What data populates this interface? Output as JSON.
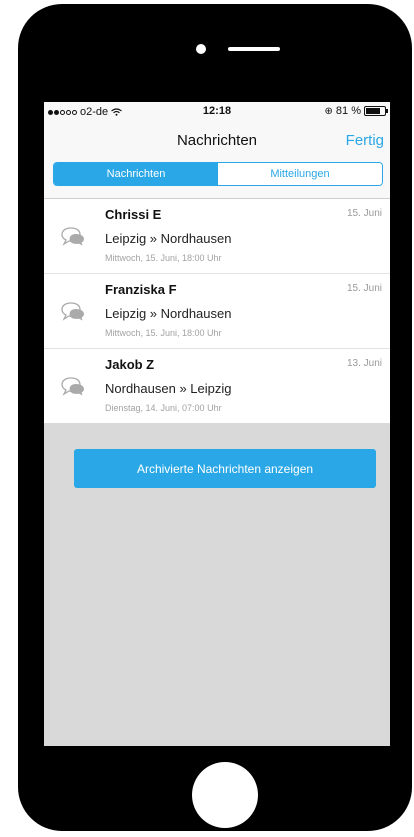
{
  "status_bar": {
    "carrier": "o2-de",
    "time": "12:18",
    "battery": "81 %"
  },
  "nav": {
    "title": "Nachrichten",
    "done_label": "Fertig"
  },
  "segments": {
    "active": "Nachrichten",
    "inactive": "Mitteilungen"
  },
  "messages": [
    {
      "name": "Chrissi E",
      "date": "15. Juni",
      "route": "Leipzig » Nordhausen",
      "time": "Mittwoch, 15. Juni, 18:00 Uhr"
    },
    {
      "name": "Franziska F",
      "date": "15. Juni",
      "route": "Leipzig » Nordhausen",
      "time": "Mittwoch, 15. Juni, 18:00 Uhr"
    },
    {
      "name": "Jakob Z",
      "date": "13. Juni",
      "route": "Nordhausen » Leipzig",
      "time": "Dienstag, 14. Juni, 07:00 Uhr"
    }
  ],
  "archive_button_label": "Archivierte Nachrichten anzeigen",
  "colors": {
    "accent": "#2aa7e6",
    "background": "#d9d9d9"
  },
  "icons": {
    "row": "chat-bubbles-icon",
    "wifi": "wifi-icon",
    "battery": "battery-icon"
  }
}
